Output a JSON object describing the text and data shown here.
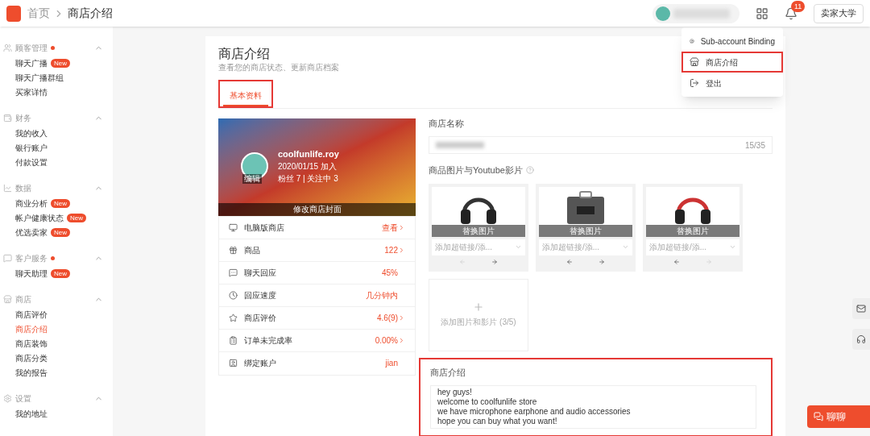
{
  "header": {
    "breadcrumb": [
      "首页",
      "商店介绍"
    ],
    "notification_count": "11",
    "university_button": "卖家大学"
  },
  "account_menu": [
    {
      "label": "Sub-account Binding",
      "annotated": false
    },
    {
      "label": "商店介绍",
      "annotated": true
    },
    {
      "label": "登出",
      "annotated": false
    }
  ],
  "sidebar": [
    {
      "title": "顾客管理",
      "dot": true,
      "items": [
        {
          "label": "聊天广播",
          "badge": "New",
          "selected": false
        },
        {
          "label": "聊天广播群组",
          "selected": false
        },
        {
          "label": "买家详情",
          "selected": false
        }
      ]
    },
    {
      "title": "财务",
      "dot": false,
      "items": [
        {
          "label": "我的收入",
          "selected": false
        },
        {
          "label": "银行账户",
          "selected": false
        },
        {
          "label": "付款设置",
          "selected": false
        }
      ]
    },
    {
      "title": "数据",
      "dot": false,
      "items": [
        {
          "label": "商业分析",
          "badge": "New",
          "selected": false
        },
        {
          "label": "帐户健康状态",
          "badge": "New",
          "selected": false
        },
        {
          "label": "优选卖家",
          "badge": "New",
          "selected": false
        }
      ]
    },
    {
      "title": "客户服务",
      "dot": true,
      "items": [
        {
          "label": "聊天助理",
          "badge": "New",
          "selected": false
        }
      ]
    },
    {
      "title": "商店",
      "dot": false,
      "items": [
        {
          "label": "商店评价",
          "selected": false
        },
        {
          "label": "商店介绍",
          "selected": true
        },
        {
          "label": "商店装饰",
          "selected": false
        },
        {
          "label": "商店分类",
          "selected": false
        },
        {
          "label": "我的报告",
          "selected": false
        }
      ]
    },
    {
      "title": "设置",
      "dot": false,
      "items": [
        {
          "label": "我的地址",
          "selected": false
        }
      ]
    }
  ],
  "page": {
    "title": "商店介绍",
    "subtitle": "查看您的商店状态、更新商店档案"
  },
  "tabs": [
    {
      "label": "基本资料",
      "selected": true,
      "annotated": true
    }
  ],
  "shop_card": {
    "name": "coolfunlife.roy",
    "joined": "2020/01/15 加入",
    "followers": "粉丝 7 | 关注中 3",
    "avatar_label": "编辑",
    "cover_button": "修改商店封面"
  },
  "stats": [
    {
      "label": "电脑版商店",
      "value": "查看",
      "link": true
    },
    {
      "label": "商品",
      "value": "122",
      "link": true
    },
    {
      "label": "聊天回应",
      "value": "45%",
      "link": false
    },
    {
      "label": "回应速度",
      "value": "几分钟内",
      "link": false
    },
    {
      "label": "商店评价",
      "value": "4.6(9)",
      "link": true
    },
    {
      "label": "订单未完成率",
      "value": "0.00%",
      "link": true
    },
    {
      "label": "绑定账户",
      "value": "jian",
      "link": false
    }
  ],
  "shop_name": {
    "label": "商店名称",
    "counter": "15/35"
  },
  "media": {
    "label": "商品图片与Youtube影片",
    "images": [
      {
        "kind": "headphones",
        "overlay": "替换图片",
        "placeholder": "添加超链接/添...",
        "prev_disabled": true,
        "next_disabled": false
      },
      {
        "kind": "case",
        "overlay": "替换图片",
        "placeholder": "添加超链接/添...",
        "prev_disabled": false,
        "next_disabled": false
      },
      {
        "kind": "headphones-red",
        "overlay": "替换图片",
        "placeholder": "添加超链接/添...",
        "prev_disabled": false,
        "next_disabled": true
      }
    ],
    "add_label": "添加图片和影片 (3/5)"
  },
  "description": {
    "label": "商店介绍",
    "annotated": true,
    "lines": [
      "hey guys!",
      "welcome to coolfunlife store",
      "we have microphone earphone and audio accessories",
      "hope you can buy what you want!"
    ]
  },
  "chat_button": "聊聊"
}
